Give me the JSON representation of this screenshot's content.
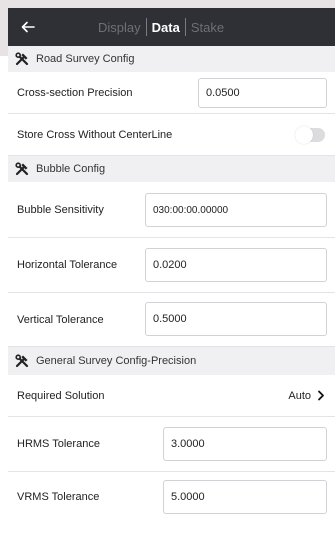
{
  "header": {
    "tabs": [
      {
        "label": "Display",
        "active": false
      },
      {
        "label": "Data",
        "active": true
      },
      {
        "label": "Stake",
        "active": false
      }
    ],
    "back_icon": "back-arrow-icon"
  },
  "sections": {
    "road": {
      "title": "Road Survey Config",
      "icon": "tools-icon"
    },
    "bubble": {
      "title": "Bubble Config",
      "icon": "tools-icon"
    },
    "general": {
      "title": "General Survey Config-Precision",
      "icon": "tools-icon"
    }
  },
  "road": {
    "cross_section_label": "Cross-section Precision",
    "cross_section_value": "0.0500",
    "store_cross_label": "Store Cross Without CenterLine",
    "store_cross_enabled": false
  },
  "bubble": {
    "sensitivity_label": "Bubble Sensitivity",
    "sensitivity_value": "030:00:00.00000",
    "horizontal_label": "Horizontal Tolerance",
    "horizontal_value": "0.0200",
    "vertical_label": "Vertical Tolerance",
    "vertical_value": "0.5000"
  },
  "general": {
    "required_solution_label": "Required Solution",
    "required_solution_value": "Auto",
    "hrms_label": "HRMS Tolerance",
    "hrms_value": "3.0000",
    "vrms_label": "VRMS Tolerance",
    "vrms_value": "5.0000"
  },
  "colors": {
    "header_bg": "#2e3036",
    "section_bg": "#f0f0f2",
    "border": "#d2d2d6"
  }
}
